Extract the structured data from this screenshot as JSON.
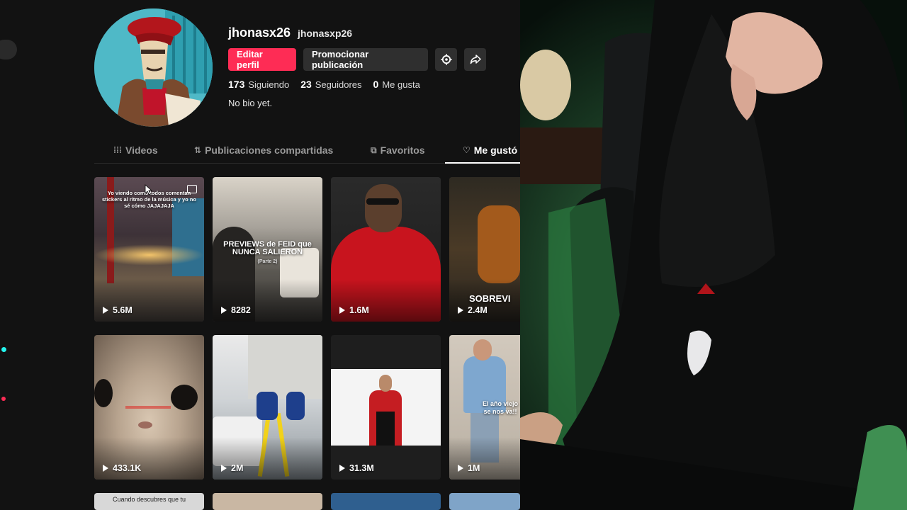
{
  "profile": {
    "username": "jhonasx26",
    "nickname": "jhonasxp26",
    "edit_label": "Editar perfil",
    "promote_label": "Promocionar publicación",
    "stats": [
      {
        "value": "173",
        "label": "Siguiendo"
      },
      {
        "value": "23",
        "label": "Seguidores"
      },
      {
        "value": "0",
        "label": "Me gusta"
      }
    ],
    "bio": "No bio yet."
  },
  "tabs": [
    {
      "icon": "grid-icon",
      "label": "Videos"
    },
    {
      "icon": "repost-icon",
      "label": "Publicaciones compartidas"
    },
    {
      "icon": "bookmark-icon",
      "label": "Favoritos"
    },
    {
      "icon": "heart-icon",
      "label": "Me gustó"
    }
  ],
  "active_tab": "Me gustó",
  "videos": [
    {
      "views": "5.6M",
      "caption": "Yo viendo como todos comentan stickers al ritmo de la música y yo no sé cómo JAJAJAJA"
    },
    {
      "views": "8282",
      "caption": "PREVIEWS de FEID que NUNCA SALIERON",
      "subcaption": "(Parte 2)"
    },
    {
      "views": "1.6M",
      "caption": ""
    },
    {
      "views": "2.4M",
      "caption": "SOBREVI"
    },
    {
      "views": "433.1K",
      "caption": ""
    },
    {
      "views": "2M",
      "caption": ""
    },
    {
      "views": "31.3M",
      "caption": ""
    },
    {
      "views": "1M",
      "caption": "El año viejo se nos va!!"
    },
    {
      "views": "",
      "caption": "Cuando descubres que tu"
    }
  ],
  "colors": {
    "accent": "#fe2c55",
    "background": "#121212",
    "secondary_button": "#2f2f2f"
  }
}
